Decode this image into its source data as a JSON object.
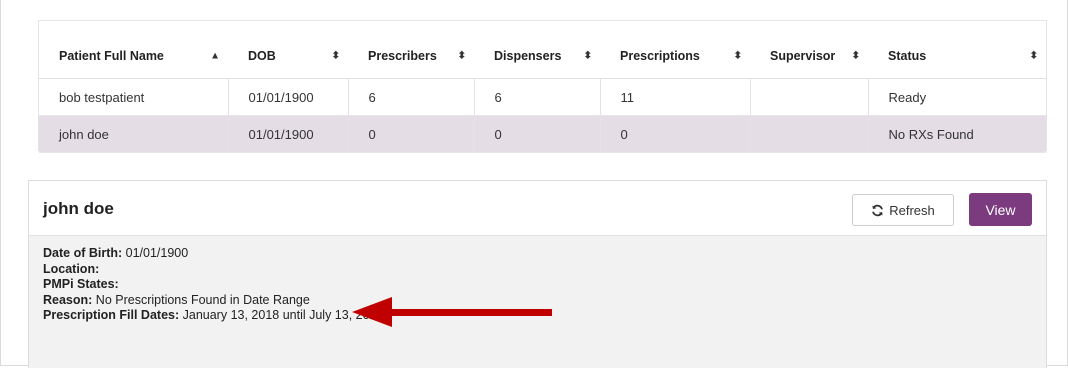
{
  "table": {
    "columns": [
      "Patient Full Name",
      "DOB",
      "Prescribers",
      "Dispensers",
      "Prescriptions",
      "Supervisor",
      "Status"
    ],
    "rows": [
      {
        "name": "bob testpatient",
        "dob": "01/01/1900",
        "prescribers": "6",
        "dispensers": "6",
        "prescriptions": "11",
        "supervisor": "",
        "status": "Ready"
      },
      {
        "name": "john doe",
        "dob": "01/01/1900",
        "prescribers": "0",
        "dispensers": "0",
        "prescriptions": "0",
        "supervisor": "",
        "status": "No RXs Found"
      }
    ],
    "sort_icon_first": "▲",
    "sort_icon": "⬍"
  },
  "detail": {
    "title": "john doe",
    "refresh_label": "Refresh",
    "view_label": "View",
    "fields": [
      {
        "label": "Date of Birth:",
        "value": " 01/01/1900"
      },
      {
        "label": "Location:",
        "value": ""
      },
      {
        "label": "PMPi States:",
        "value": ""
      },
      {
        "label": "Reason:",
        "value": " No Prescriptions Found in Date Range"
      },
      {
        "label": "Prescription Fill Dates:",
        "value": " January 13, 2018 until July 13, 2018"
      }
    ]
  },
  "colors": {
    "accent": "#7b3b7e",
    "selected_row": "#e4dde6",
    "ready": "#4cae4c",
    "arrow": "#c00000"
  },
  "icons": {
    "refresh": "refresh-icon",
    "arrow": "annotation-arrow-icon"
  }
}
